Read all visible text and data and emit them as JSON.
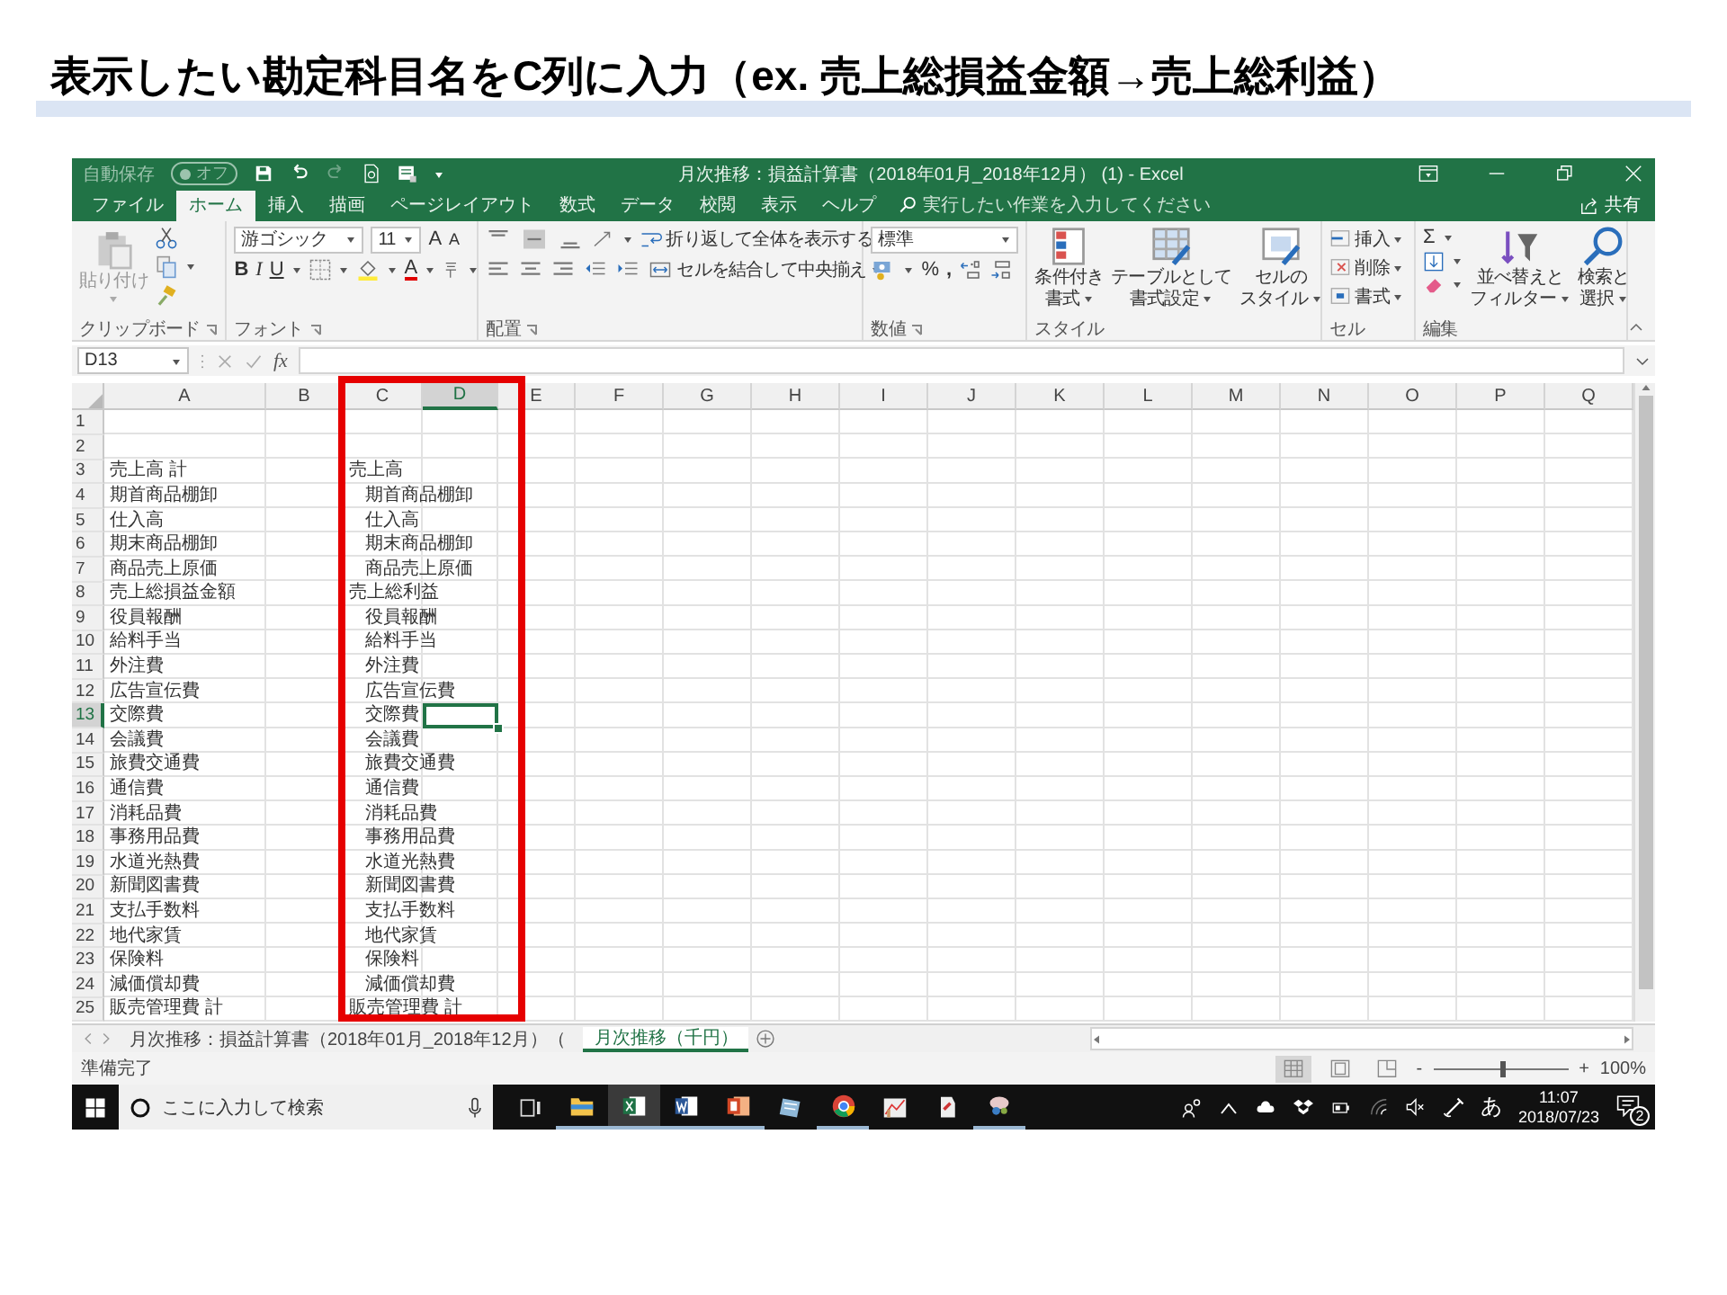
{
  "slide_heading": "表示したい勘定科目名をC列に入力（ex. 売上総損益金額→売上総利益）",
  "excel": {
    "title_bar": {
      "autosave_label": "自動保存",
      "autosave_state": "オフ",
      "autosave_on": false,
      "title": "月次推移：損益計算書（2018年01月_2018年12月） (1) - Excel"
    },
    "ribbon_tabs": [
      {
        "label": "ファイル",
        "selected": false
      },
      {
        "label": "ホーム",
        "selected": true
      },
      {
        "label": "挿入",
        "selected": false
      },
      {
        "label": "描画",
        "selected": false
      },
      {
        "label": "ページレイアウト",
        "selected": false
      },
      {
        "label": "数式",
        "selected": false
      },
      {
        "label": "データ",
        "selected": false
      },
      {
        "label": "校閲",
        "selected": false
      },
      {
        "label": "表示",
        "selected": false
      },
      {
        "label": "ヘルプ",
        "selected": false
      }
    ],
    "tell_me": {
      "placeholder": "実行したい作業を入力してください"
    },
    "share": "共有",
    "ribbon": {
      "clipboard": {
        "label": "クリップボード",
        "paste": {
          "label": "貼り付け",
          "disabled": true
        }
      },
      "font": {
        "label": "フォント",
        "font_name": "游ゴシック",
        "font_size": "11",
        "grow": "A",
        "shrink": "A",
        "bold": "B",
        "italic": "I",
        "underline": "U",
        "font_color": "A"
      },
      "alignment": {
        "label": "配置",
        "wrap_text": "折り返して全体を表示する",
        "merge_center": "セルを結合して中央揃え"
      },
      "number": {
        "label": "数値",
        "format": "標準",
        "percent": "%",
        "comma": ","
      },
      "styles": {
        "label": "スタイル",
        "conditional": [
          "条件付き",
          "書式"
        ],
        "table": [
          "テーブルとして",
          "書式設定"
        ],
        "cell_styles": [
          "セルの",
          "スタイル"
        ]
      },
      "cells": {
        "label": "セル",
        "insert": "挿入",
        "delete": "削除",
        "format": "書式"
      },
      "editing": {
        "label": "編集",
        "sum": "Σ",
        "sort_filter": [
          "並べ替えと",
          "フィルター"
        ],
        "find_select": [
          "検索と",
          "選択"
        ]
      }
    },
    "formula_bar": {
      "name_box": "D13",
      "function_label": "fx"
    },
    "columns": [
      {
        "label": "A",
        "selected": false
      },
      {
        "label": "B",
        "selected": false
      },
      {
        "label": "C",
        "selected": false
      },
      {
        "label": "D",
        "selected": true
      },
      {
        "label": "E",
        "selected": false
      },
      {
        "label": "F",
        "selected": false
      },
      {
        "label": "G",
        "selected": false
      },
      {
        "label": "H",
        "selected": false
      },
      {
        "label": "I",
        "selected": false
      },
      {
        "label": "J",
        "selected": false
      },
      {
        "label": "K",
        "selected": false
      },
      {
        "label": "L",
        "selected": false
      },
      {
        "label": "M",
        "selected": false
      },
      {
        "label": "N",
        "selected": false
      },
      {
        "label": "O",
        "selected": false
      },
      {
        "label": "P",
        "selected": false
      },
      {
        "label": "Q",
        "selected": false
      }
    ],
    "rows": [
      {
        "number": "1",
        "selected": false
      },
      {
        "number": "2",
        "selected": false
      },
      {
        "number": "3",
        "selected": false,
        "col_a": "売上高 計",
        "col_c": "売上高",
        "c_indented": false
      },
      {
        "number": "4",
        "selected": false,
        "col_a": "期首商品棚卸",
        "col_c": "期首商品棚卸",
        "c_indented": true
      },
      {
        "number": "5",
        "selected": false,
        "col_a": "仕入高",
        "col_c": "仕入高",
        "c_indented": true
      },
      {
        "number": "6",
        "selected": false,
        "col_a": "期末商品棚卸",
        "col_c": "期末商品棚卸",
        "c_indented": true
      },
      {
        "number": "7",
        "selected": false,
        "col_a": "商品売上原価",
        "col_c": "商品売上原価",
        "c_indented": true
      },
      {
        "number": "8",
        "selected": false,
        "col_a": "売上総損益金額",
        "col_c": "売上総利益",
        "c_indented": false
      },
      {
        "number": "9",
        "selected": false,
        "col_a": "役員報酬",
        "col_c": "役員報酬",
        "c_indented": true
      },
      {
        "number": "10",
        "selected": false,
        "col_a": "給料手当",
        "col_c": "給料手当",
        "c_indented": true
      },
      {
        "number": "11",
        "selected": false,
        "col_a": "外注費",
        "col_c": "外注費",
        "c_indented": true
      },
      {
        "number": "12",
        "selected": false,
        "col_a": "広告宣伝費",
        "col_c": "広告宣伝費",
        "c_indented": true
      },
      {
        "number": "13",
        "selected": true,
        "col_a": "交際費",
        "col_c": "交際費",
        "c_indented": true
      },
      {
        "number": "14",
        "selected": false,
        "col_a": "会議費",
        "col_c": "会議費",
        "c_indented": true
      },
      {
        "number": "15",
        "selected": false,
        "col_a": "旅費交通費",
        "col_c": "旅費交通費",
        "c_indented": true
      },
      {
        "number": "16",
        "selected": false,
        "col_a": "通信費",
        "col_c": "通信費",
        "c_indented": true
      },
      {
        "number": "17",
        "selected": false,
        "col_a": "消耗品費",
        "col_c": "消耗品費",
        "c_indented": true
      },
      {
        "number": "18",
        "selected": false,
        "col_a": "事務用品費",
        "col_c": "事務用品費",
        "c_indented": true
      },
      {
        "number": "19",
        "selected": false,
        "col_a": "水道光熱費",
        "col_c": "水道光熱費",
        "c_indented": true
      },
      {
        "number": "20",
        "selected": false,
        "col_a": "新聞図書費",
        "col_c": "新聞図書費",
        "c_indented": true
      },
      {
        "number": "21",
        "selected": false,
        "col_a": "支払手数料",
        "col_c": "支払手数料",
        "c_indented": true
      },
      {
        "number": "22",
        "selected": false,
        "col_a": "地代家賃",
        "col_c": "地代家賃",
        "c_indented": true
      },
      {
        "number": "23",
        "selected": false,
        "col_a": "保険料",
        "col_c": "保険料",
        "c_indented": true
      },
      {
        "number": "24",
        "selected": false,
        "col_a": "減価償却費",
        "col_c": "減価償却費",
        "c_indented": true
      },
      {
        "number": "25",
        "selected": false,
        "col_a": "販売管理費 計",
        "col_c": "販売管理費 計",
        "c_indented": false
      }
    ],
    "sheet_tabs": [
      {
        "label": "月次推移：損益計算書（2018年01月_2018年12月）（",
        "selected": false
      },
      {
        "label": "月次推移（千円）",
        "selected": true
      }
    ],
    "status_bar": {
      "status": "準備完了",
      "view_buttons": [
        {
          "kind": "normal",
          "selected": true
        },
        {
          "kind": "page_layout",
          "selected": false
        },
        {
          "kind": "page_break",
          "selected": false
        }
      ],
      "zoom_out": "-",
      "zoom_slider": {
        "level": 0.5
      },
      "zoom_in": "+",
      "zoom": "100%"
    }
  },
  "taskbar": {
    "search": {
      "placeholder": "ここに入力して検索"
    },
    "apps": [
      {
        "kind": "task_view",
        "running": false,
        "selected": false
      },
      {
        "kind": "explorer",
        "running": true,
        "selected": false
      },
      {
        "kind": "excel",
        "running": true,
        "selected": true
      },
      {
        "kind": "word",
        "running": true,
        "selected": false
      },
      {
        "kind": "powerpoint",
        "running": true,
        "selected": false
      },
      {
        "kind": "notes",
        "running": false,
        "selected": false
      },
      {
        "kind": "chrome",
        "running": true,
        "selected": false
      },
      {
        "kind": "paint",
        "running": false,
        "selected": false
      },
      {
        "kind": "document",
        "running": false,
        "selected": false
      },
      {
        "kind": "network",
        "running": true,
        "selected": false
      }
    ],
    "ime": "あ",
    "time": "11:07",
    "date": "2018/07/23",
    "notifications": "2"
  }
}
